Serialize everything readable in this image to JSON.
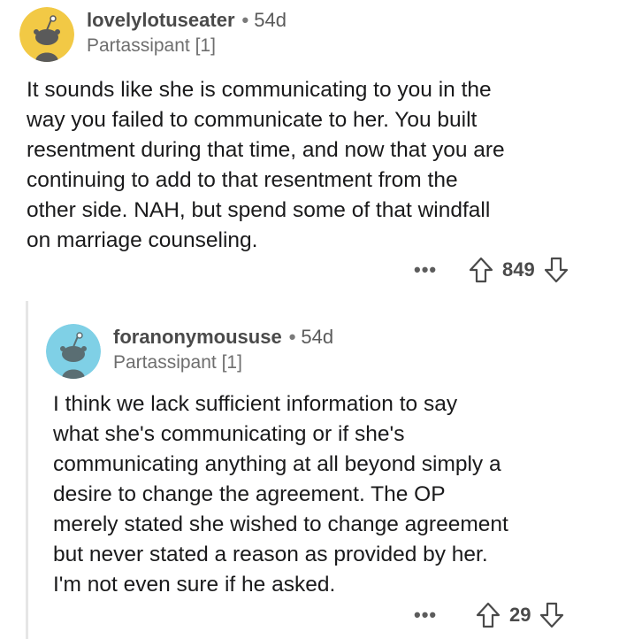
{
  "comments": [
    {
      "username": "lovelylotuseater",
      "separator": "•",
      "age": "54d",
      "flair": "Partassipant [1]",
      "lines": [
        "It sounds like she is communicating to you in the",
        "way you failed to communicate to her. You built",
        "resentment during that time, and now that you are",
        "continuing to add to that resentment from the",
        "other side. NAH, but spend some of that windfall",
        "on marriage counseling."
      ],
      "more": "•••",
      "score": "849",
      "avatar_color": "#f2c945"
    },
    {
      "username": "foranonymoususe",
      "separator": "•",
      "age": "54d",
      "flair": "Partassipant [1]",
      "lines": [
        "I think we lack sufficient information to say",
        "what she's communicating or if she's",
        "communicating anything at all beyond simply a",
        "desire to change the agreement. The OP",
        "merely stated she wished to change agreement",
        "but never stated a reason as provided by her.",
        "I'm not even sure if he asked."
      ],
      "more": "•••",
      "score": "29",
      "avatar_color": "#7fd0e6"
    }
  ]
}
